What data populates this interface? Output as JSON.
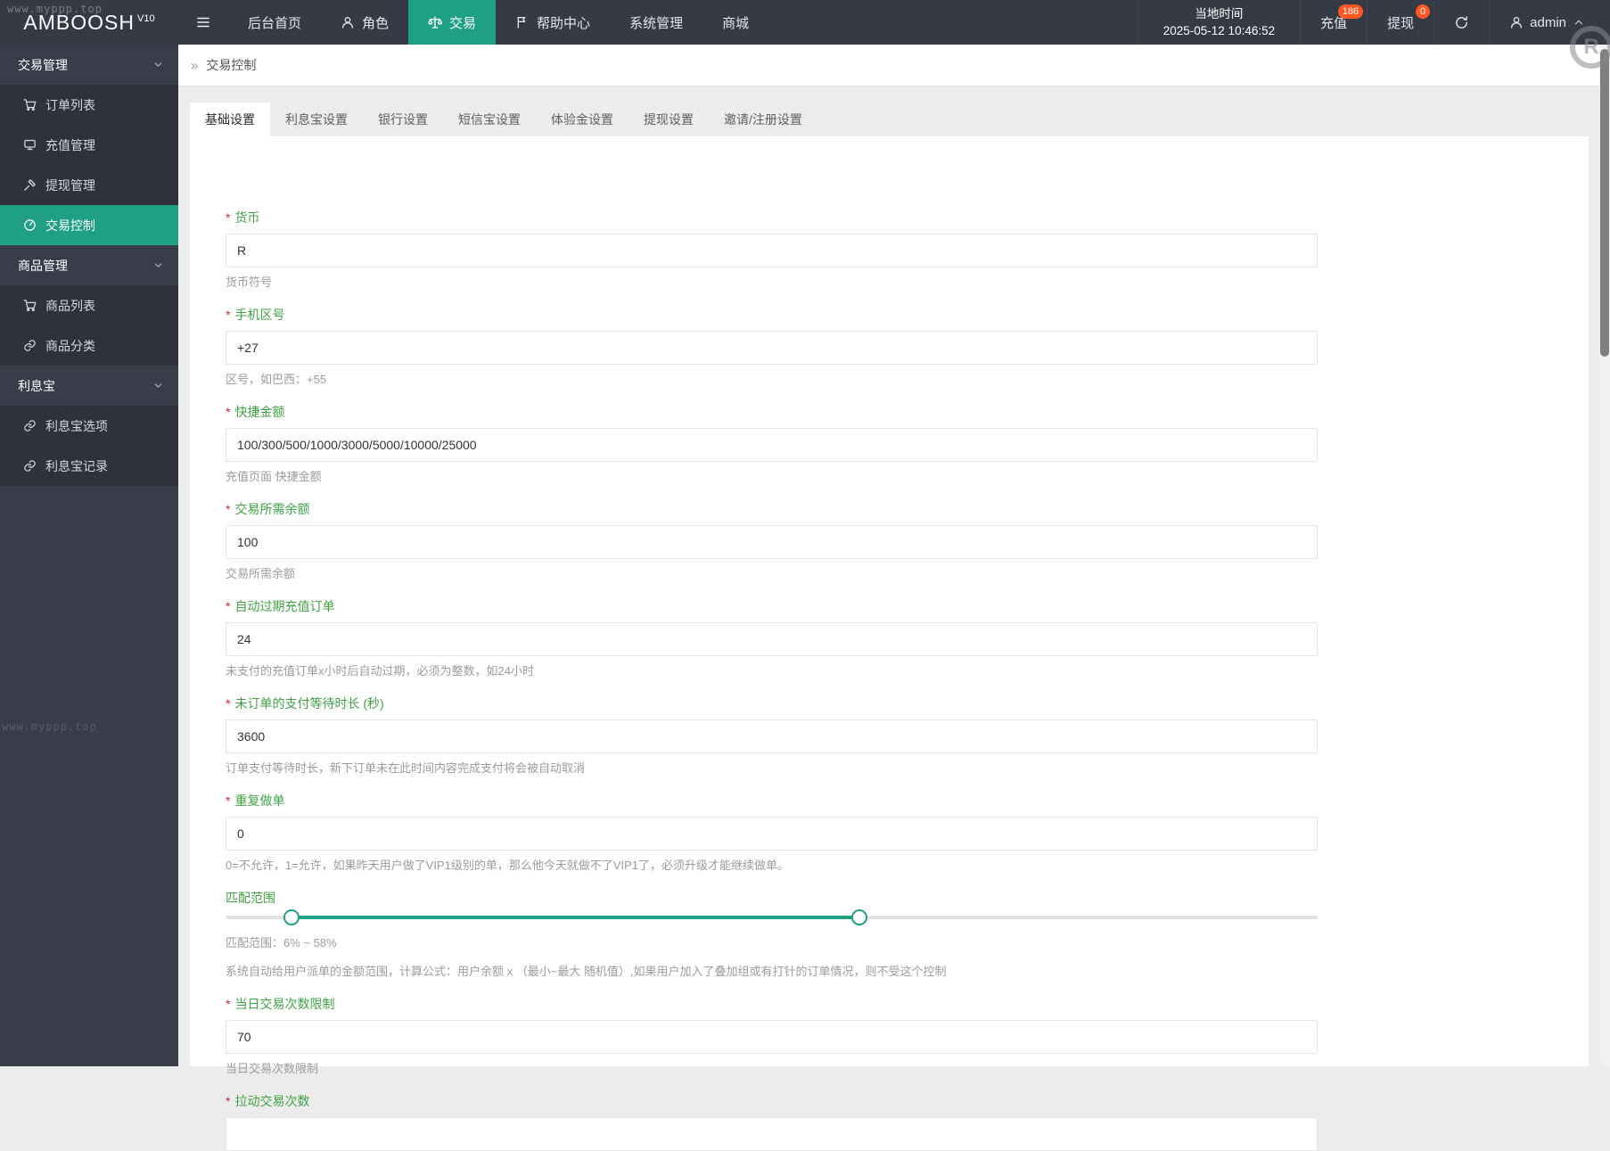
{
  "watermark": {
    "site": "www.myppp.top",
    "registered": "R"
  },
  "colors": {
    "accent": "#1fa085",
    "badge": "#ff5722",
    "label_green": "#3fa344",
    "required_red": "#cc2929",
    "sidebar_bg": "#393d49",
    "sidebar_sub_bg": "#2f323b",
    "header_bg": "#363a45",
    "page_bg": "#ececec"
  },
  "header": {
    "logo": "AMBOOSH",
    "logo_version": "V10",
    "nav": [
      {
        "name": "home",
        "label": "后台首页",
        "icon": null,
        "active": false
      },
      {
        "name": "roles",
        "label": "角色",
        "icon": "user",
        "active": false
      },
      {
        "name": "trade",
        "label": "交易",
        "icon": "scales",
        "active": true
      },
      {
        "name": "help-center",
        "label": "帮助中心",
        "icon": "flag",
        "active": false
      },
      {
        "name": "system",
        "label": "系统管理",
        "icon": null,
        "active": false
      },
      {
        "name": "mall",
        "label": "商城",
        "icon": null,
        "active": false
      }
    ],
    "local_time_label": "当地时间",
    "local_time": "2025-05-12 10:46:52",
    "recharge": {
      "label": "充值",
      "badge": "186"
    },
    "withdraw": {
      "label": "提现",
      "badge": "0"
    },
    "username": "admin"
  },
  "sidebar": {
    "groups": [
      {
        "name": "trade-management",
        "label": "交易管理",
        "items": [
          {
            "name": "order-list",
            "label": "订单列表",
            "icon": "cart",
            "active": false
          },
          {
            "name": "recharge-management",
            "label": "充值管理",
            "icon": "screen",
            "active": false
          },
          {
            "name": "withdraw-management",
            "label": "提现管理",
            "icon": "gavel",
            "active": false
          },
          {
            "name": "trade-control",
            "label": "交易控制",
            "icon": "gauge",
            "active": true
          }
        ]
      },
      {
        "name": "product-management",
        "label": "商品管理",
        "items": [
          {
            "name": "product-list",
            "label": "商品列表",
            "icon": "cart",
            "active": false
          },
          {
            "name": "product-category",
            "label": "商品分类",
            "icon": "link",
            "active": false
          }
        ]
      },
      {
        "name": "lixibao",
        "label": "利息宝",
        "items": [
          {
            "name": "lixibao-options",
            "label": "利息宝选项",
            "icon": "link",
            "active": false
          },
          {
            "name": "lixibao-records",
            "label": "利息宝记录",
            "icon": "link",
            "active": false
          }
        ]
      }
    ]
  },
  "breadcrumb": {
    "symbol": "»",
    "label": "交易控制"
  },
  "tabs": [
    {
      "name": "basic-settings",
      "label": "基础设置",
      "active": true
    },
    {
      "name": "lixibao-settings",
      "label": "利息宝设置",
      "active": false
    },
    {
      "name": "bank-settings",
      "label": "银行设置",
      "active": false
    },
    {
      "name": "sms-settings",
      "label": "短信宝设置",
      "active": false
    },
    {
      "name": "trial-bonus-settings",
      "label": "体验金设置",
      "active": false
    },
    {
      "name": "withdraw-settings",
      "label": "提现设置",
      "active": false
    },
    {
      "name": "invite-register-settings",
      "label": "邀请/注册设置",
      "active": false
    }
  ],
  "form": {
    "blocks": [
      {
        "type": "field",
        "name": "currency",
        "required": true,
        "label": "货币",
        "value": "R",
        "help": "货币符号"
      },
      {
        "type": "field",
        "name": "phone-area-code",
        "required": true,
        "label": "手机区号",
        "value": "+27",
        "help": "区号，如巴西：+55"
      },
      {
        "type": "field",
        "name": "quick-amounts",
        "required": true,
        "label": "快捷金额",
        "value": "100/300/500/1000/3000/5000/10000/25000",
        "help": "充值页面 快捷金额"
      },
      {
        "type": "field",
        "name": "required-balance",
        "required": true,
        "label": "交易所需余额",
        "value": "100",
        "help": "交易所需余额"
      },
      {
        "type": "field",
        "name": "auto-expire-recharge-order",
        "required": true,
        "label": "自动过期充值订单",
        "value": "24",
        "help": "未支付的充值订单x小时后自动过期，必须为整数，如24小时"
      },
      {
        "type": "field",
        "name": "order-payment-wait-seconds",
        "required": true,
        "label": "未订单的支付等待时长 (秒)",
        "value": "3600",
        "help": "订单支付等待时长，新下订单未在此时间内容完成支付将会被自动取消"
      },
      {
        "type": "field",
        "name": "repeat-order",
        "required": true,
        "label": "重复做单",
        "value": "0",
        "help": "0=不允许，1=允许，如果昨天用户做了VIP1级别的单，那么他今天就做不了VIP1了，必须升级才能继续做单。"
      },
      {
        "type": "slider",
        "name": "match-range",
        "label": "匹配范围",
        "min_pct": 6,
        "max_pct": 58,
        "caption": "匹配范围：6% ~ 58%",
        "description": "系统自动给用户派单的金额范围，计算公式：用户余额 x （最小~最大 随机值）,如果用户加入了叠加组或有打针的订单情况，则不受这个控制"
      },
      {
        "type": "field",
        "name": "daily-trade-limit",
        "required": true,
        "label": "当日交易次数限制",
        "value": "70",
        "help": "当日交易次数限制"
      },
      {
        "type": "field",
        "name": "pull-trade-count",
        "required": true,
        "label": "拉动交易次数",
        "value": "",
        "help": ""
      }
    ]
  }
}
